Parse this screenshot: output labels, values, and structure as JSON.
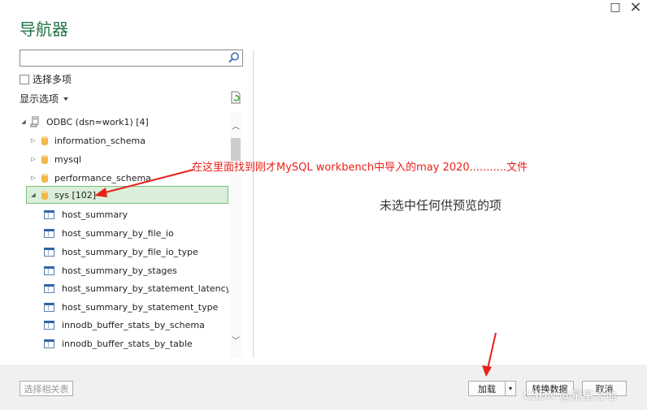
{
  "window": {
    "title": "导航器",
    "maximize_icon": "□",
    "close_icon": "×"
  },
  "left_panel": {
    "search": {
      "placeholder": "",
      "value": ""
    },
    "select_multiple": {
      "label": "选择多项",
      "checked": false
    },
    "display_options": {
      "label": "显示选项"
    }
  },
  "tree": {
    "root": {
      "label": "ODBC (dsn=work1) [4]"
    },
    "databases": [
      {
        "label": "information_schema",
        "expanded": false
      },
      {
        "label": "mysql",
        "expanded": false
      },
      {
        "label": "performance_schema",
        "expanded": false
      },
      {
        "label": "sys [102]",
        "expanded": true,
        "selected": true
      }
    ],
    "tables": [
      {
        "label": "host_summary"
      },
      {
        "label": "host_summary_by_file_io"
      },
      {
        "label": "host_summary_by_file_io_type"
      },
      {
        "label": "host_summary_by_stages"
      },
      {
        "label": "host_summary_by_statement_latency"
      },
      {
        "label": "host_summary_by_statement_type"
      },
      {
        "label": "innodb_buffer_stats_by_schema"
      },
      {
        "label": "innodb_buffer_stats_by_table"
      }
    ]
  },
  "preview": {
    "message": "未选中任何供预览的项"
  },
  "annotation": {
    "text": "在这里面找到刚才MySQL workbench中导入的may 2020...........文件",
    "color": "#e8211b"
  },
  "footer": {
    "select_related_label": "选择相关表",
    "load_label": "加载",
    "transform_label": "转换数据",
    "cancel_label": "取消"
  },
  "watermark": {
    "text": "CSDN @星星之地"
  },
  "colors": {
    "title": "#217346",
    "selected_bg": "#d9efd9",
    "annotation": "#e8211b"
  }
}
